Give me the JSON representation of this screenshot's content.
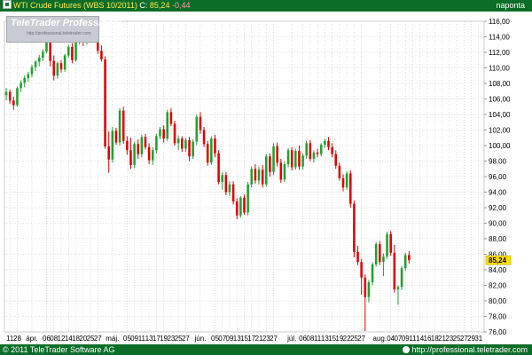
{
  "header": {
    "instrument": "WTI Crude Futures (WBS 10/2011)",
    "close_label": "C:",
    "close_value": "85,24",
    "change_value": "-0,44",
    "period": "napontа"
  },
  "watermark": {
    "brand": "TeleTrader Professional",
    "url": "http://professional.teletrader.com"
  },
  "footer": {
    "copyright": "© 2011 TeleTrader Software AG",
    "url": "http://professional.teletrader.com"
  },
  "colors": {
    "frame": "#0b6d27",
    "up": "#20a030",
    "down": "#e00000",
    "grid": "#c8c8c8",
    "axis_text": "#000000"
  },
  "chart_data": {
    "type": "candlestick",
    "title": "WTI Crude Futures (WBS 10/2011)",
    "ylim": [
      76,
      116
    ],
    "y_ticks": [
      "116,00",
      "114,00",
      "112,00",
      "110,00",
      "108,00",
      "106,00",
      "104,00",
      "102,00",
      "100,00",
      "98,00",
      "96,00",
      "94,00",
      "92,00",
      "90,00",
      "88,00",
      "86,00",
      "84,00",
      "82,00",
      "80,00",
      "78,00",
      "76,00"
    ],
    "last_price_label": "85,24",
    "last_price": 85.24,
    "grid": true,
    "x_labels": [
      {
        "i": 1,
        "label": "11"
      },
      {
        "i": 3,
        "label": "28"
      },
      {
        "i": 7,
        "label": "ápr."
      },
      {
        "i": 11,
        "label": "06"
      },
      {
        "i": 13,
        "label": "08"
      },
      {
        "i": 15,
        "label": "12"
      },
      {
        "i": 17,
        "label": "14"
      },
      {
        "i": 19,
        "label": "18"
      },
      {
        "i": 21,
        "label": "20"
      },
      {
        "i": 23,
        "label": "25"
      },
      {
        "i": 25,
        "label": "27"
      },
      {
        "i": 29,
        "label": "máj."
      },
      {
        "i": 33,
        "label": "05"
      },
      {
        "i": 35,
        "label": "09"
      },
      {
        "i": 37,
        "label": "11"
      },
      {
        "i": 39,
        "label": "13"
      },
      {
        "i": 41,
        "label": "17"
      },
      {
        "i": 43,
        "label": "19"
      },
      {
        "i": 45,
        "label": "23"
      },
      {
        "i": 47,
        "label": "25"
      },
      {
        "i": 49,
        "label": "27"
      },
      {
        "i": 53,
        "label": "jún."
      },
      {
        "i": 57,
        "label": "05"
      },
      {
        "i": 59,
        "label": "07"
      },
      {
        "i": 61,
        "label": "09"
      },
      {
        "i": 63,
        "label": "13"
      },
      {
        "i": 65,
        "label": "15"
      },
      {
        "i": 67,
        "label": "17"
      },
      {
        "i": 69,
        "label": "21"
      },
      {
        "i": 71,
        "label": "23"
      },
      {
        "i": 73,
        "label": "27"
      },
      {
        "i": 78,
        "label": "júl."
      },
      {
        "i": 81,
        "label": "06"
      },
      {
        "i": 83,
        "label": "08"
      },
      {
        "i": 85,
        "label": "11"
      },
      {
        "i": 87,
        "label": "13"
      },
      {
        "i": 89,
        "label": "15"
      },
      {
        "i": 91,
        "label": "19"
      },
      {
        "i": 93,
        "label": "22"
      },
      {
        "i": 95,
        "label": "25"
      },
      {
        "i": 97,
        "label": "27"
      },
      {
        "i": 102,
        "label": "aug."
      },
      {
        "i": 105,
        "label": "04"
      },
      {
        "i": 107,
        "label": "07"
      },
      {
        "i": 109,
        "label": "09"
      },
      {
        "i": 111,
        "label": "11"
      },
      {
        "i": 113,
        "label": "14"
      },
      {
        "i": 115,
        "label": "16"
      },
      {
        "i": 117,
        "label": "18"
      },
      {
        "i": 119,
        "label": "21"
      },
      {
        "i": 121,
        "label": "23"
      },
      {
        "i": 123,
        "label": "25"
      },
      {
        "i": 125,
        "label": "27"
      },
      {
        "i": 127,
        "label": "29"
      },
      {
        "i": 129,
        "label": "31"
      }
    ],
    "candles": [
      [
        106.5,
        107.4,
        105.8,
        106.9
      ],
      [
        106.9,
        107.2,
        105.4,
        105.8
      ],
      [
        105.8,
        106.3,
        104.6,
        105.2
      ],
      [
        105.2,
        107.6,
        105.0,
        107.4
      ],
      [
        107.4,
        108.4,
        106.9,
        108.1
      ],
      [
        108.1,
        109.0,
        107.5,
        108.7
      ],
      [
        108.7,
        109.5,
        108.2,
        109.2
      ],
      [
        109.2,
        110.4,
        108.8,
        110.1
      ],
      [
        110.1,
        111.0,
        109.6,
        110.8
      ],
      [
        110.8,
        111.7,
        110.2,
        111.3
      ],
      [
        111.3,
        112.4,
        110.9,
        112.1
      ],
      [
        112.1,
        114.9,
        111.9,
        114.5
      ],
      [
        114.5,
        115.0,
        110.2,
        110.9
      ],
      [
        110.9,
        111.6,
        108.4,
        109.0
      ],
      [
        109.0,
        110.8,
        108.6,
        110.6
      ],
      [
        110.6,
        111.0,
        109.4,
        109.8
      ],
      [
        109.8,
        111.8,
        109.5,
        111.6
      ],
      [
        111.6,
        113.0,
        111.3,
        112.7
      ],
      [
        112.7,
        113.2,
        110.6,
        111.0
      ],
      [
        111.0,
        113.6,
        110.8,
        113.4
      ],
      [
        113.4,
        114.3,
        113.0,
        114.1
      ],
      [
        114.1,
        114.6,
        112.8,
        113.3
      ],
      [
        113.3,
        114.8,
        113.0,
        114.5
      ],
      [
        114.5,
        115.4,
        114.0,
        114.9
      ],
      [
        114.9,
        115.3,
        113.3,
        113.6
      ],
      [
        113.6,
        114.0,
        111.8,
        112.2
      ],
      [
        112.2,
        112.9,
        110.8,
        111.1
      ],
      [
        111.1,
        111.5,
        99.6,
        99.9
      ],
      [
        99.9,
        101.8,
        96.5,
        98.2
      ],
      [
        98.2,
        102.4,
        97.8,
        101.9
      ],
      [
        101.9,
        102.3,
        100.1,
        100.4
      ],
      [
        100.4,
        104.8,
        100.0,
        104.5
      ],
      [
        104.5,
        105.0,
        100.2,
        100.6
      ],
      [
        100.6,
        101.2,
        98.8,
        99.4
      ],
      [
        99.4,
        101.0,
        97.0,
        97.5
      ],
      [
        97.5,
        100.5,
        97.1,
        100.2
      ],
      [
        100.2,
        100.8,
        98.3,
        98.9
      ],
      [
        98.9,
        101.4,
        98.5,
        101.1
      ],
      [
        101.1,
        101.5,
        99.5,
        99.8
      ],
      [
        99.8,
        100.3,
        97.6,
        98.1
      ],
      [
        98.1,
        99.8,
        97.5,
        99.4
      ],
      [
        99.4,
        101.5,
        99.0,
        101.2
      ],
      [
        101.2,
        102.4,
        100.8,
        102.1
      ],
      [
        102.1,
        102.6,
        100.4,
        100.9
      ],
      [
        100.9,
        104.6,
        100.6,
        104.3
      ],
      [
        104.3,
        104.8,
        102.5,
        102.8
      ],
      [
        102.8,
        103.2,
        100.0,
        100.3
      ],
      [
        100.3,
        101.3,
        99.4,
        100.9
      ],
      [
        100.9,
        101.2,
        99.2,
        99.6
      ],
      [
        99.6,
        101.0,
        99.2,
        100.7
      ],
      [
        100.7,
        101.1,
        98.0,
        98.6
      ],
      [
        98.6,
        100.8,
        98.3,
        100.5
      ],
      [
        100.5,
        104.0,
        100.1,
        103.7
      ],
      [
        103.7,
        104.3,
        101.5,
        102.0
      ],
      [
        102.0,
        102.4,
        99.8,
        100.2
      ],
      [
        100.2,
        100.6,
        97.4,
        97.8
      ],
      [
        97.8,
        101.2,
        97.5,
        100.9
      ],
      [
        100.9,
        101.4,
        98.5,
        99.0
      ],
      [
        99.0,
        99.4,
        95.0,
        95.3
      ],
      [
        95.3,
        96.6,
        94.3,
        96.2
      ],
      [
        96.2,
        96.6,
        93.6,
        94.0
      ],
      [
        94.0,
        95.4,
        93.5,
        95.0
      ],
      [
        95.0,
        95.4,
        92.4,
        92.8
      ],
      [
        92.8,
        93.2,
        90.5,
        91.0
      ],
      [
        91.0,
        93.5,
        90.7,
        93.3
      ],
      [
        93.3,
        93.7,
        91.1,
        91.4
      ],
      [
        91.4,
        95.3,
        91.0,
        95.0
      ],
      [
        95.0,
        97.3,
        94.6,
        97.0
      ],
      [
        97.0,
        97.6,
        95.1,
        95.5
      ],
      [
        95.5,
        97.3,
        95.0,
        96.9
      ],
      [
        96.9,
        97.5,
        94.6,
        95.0
      ],
      [
        95.0,
        98.9,
        94.7,
        98.6
      ],
      [
        98.6,
        99.0,
        96.0,
        96.6
      ],
      [
        96.6,
        100.3,
        96.2,
        99.9
      ],
      [
        99.9,
        100.4,
        97.3,
        97.8
      ],
      [
        97.8,
        98.3,
        95.2,
        95.6
      ],
      [
        95.6,
        98.0,
        95.3,
        97.6
      ],
      [
        97.6,
        99.7,
        97.2,
        99.4
      ],
      [
        99.4,
        99.8,
        96.8,
        97.2
      ],
      [
        97.2,
        99.6,
        96.9,
        99.3
      ],
      [
        99.3,
        100.0,
        96.9,
        97.3
      ],
      [
        97.3,
        99.0,
        96.9,
        98.7
      ],
      [
        98.7,
        100.6,
        98.3,
        100.3
      ],
      [
        100.3,
        100.7,
        98.0,
        98.3
      ],
      [
        98.3,
        99.4,
        97.8,
        99.1
      ],
      [
        99.1,
        99.6,
        98.5,
        98.9
      ],
      [
        98.9,
        100.3,
        98.6,
        100.1
      ],
      [
        100.1,
        100.9,
        99.7,
        100.6
      ],
      [
        100.6,
        101.1,
        99.4,
        99.8
      ],
      [
        99.8,
        100.3,
        98.5,
        98.9
      ],
      [
        98.9,
        99.4,
        97.0,
        97.4
      ],
      [
        97.4,
        97.8,
        95.5,
        95.8
      ],
      [
        95.8,
        96.3,
        94.1,
        94.6
      ],
      [
        94.6,
        96.7,
        94.3,
        96.4
      ],
      [
        96.4,
        96.8,
        92.0,
        92.5
      ],
      [
        92.5,
        92.9,
        85.6,
        86.3
      ],
      [
        86.3,
        87.1,
        84.6,
        85.0
      ],
      [
        85.0,
        85.4,
        80.8,
        83.0
      ],
      [
        83.0,
        83.4,
        76.1,
        80.5
      ],
      [
        80.5,
        82.7,
        79.8,
        82.4
      ],
      [
        82.4,
        85.0,
        82.0,
        84.7
      ],
      [
        84.7,
        87.6,
        84.4,
        87.3
      ],
      [
        87.3,
        87.7,
        84.6,
        85.0
      ],
      [
        85.0,
        86.1,
        83.2,
        85.7
      ],
      [
        85.7,
        88.9,
        85.4,
        88.6
      ],
      [
        88.6,
        89.0,
        85.8,
        86.2
      ],
      [
        86.2,
        87.2,
        81.1,
        81.5
      ],
      [
        81.5,
        82.0,
        79.5,
        81.8
      ],
      [
        81.8,
        84.5,
        81.4,
        84.2
      ],
      [
        84.2,
        86.2,
        83.9,
        85.9
      ],
      [
        85.9,
        86.4,
        84.8,
        85.24
      ]
    ]
  }
}
